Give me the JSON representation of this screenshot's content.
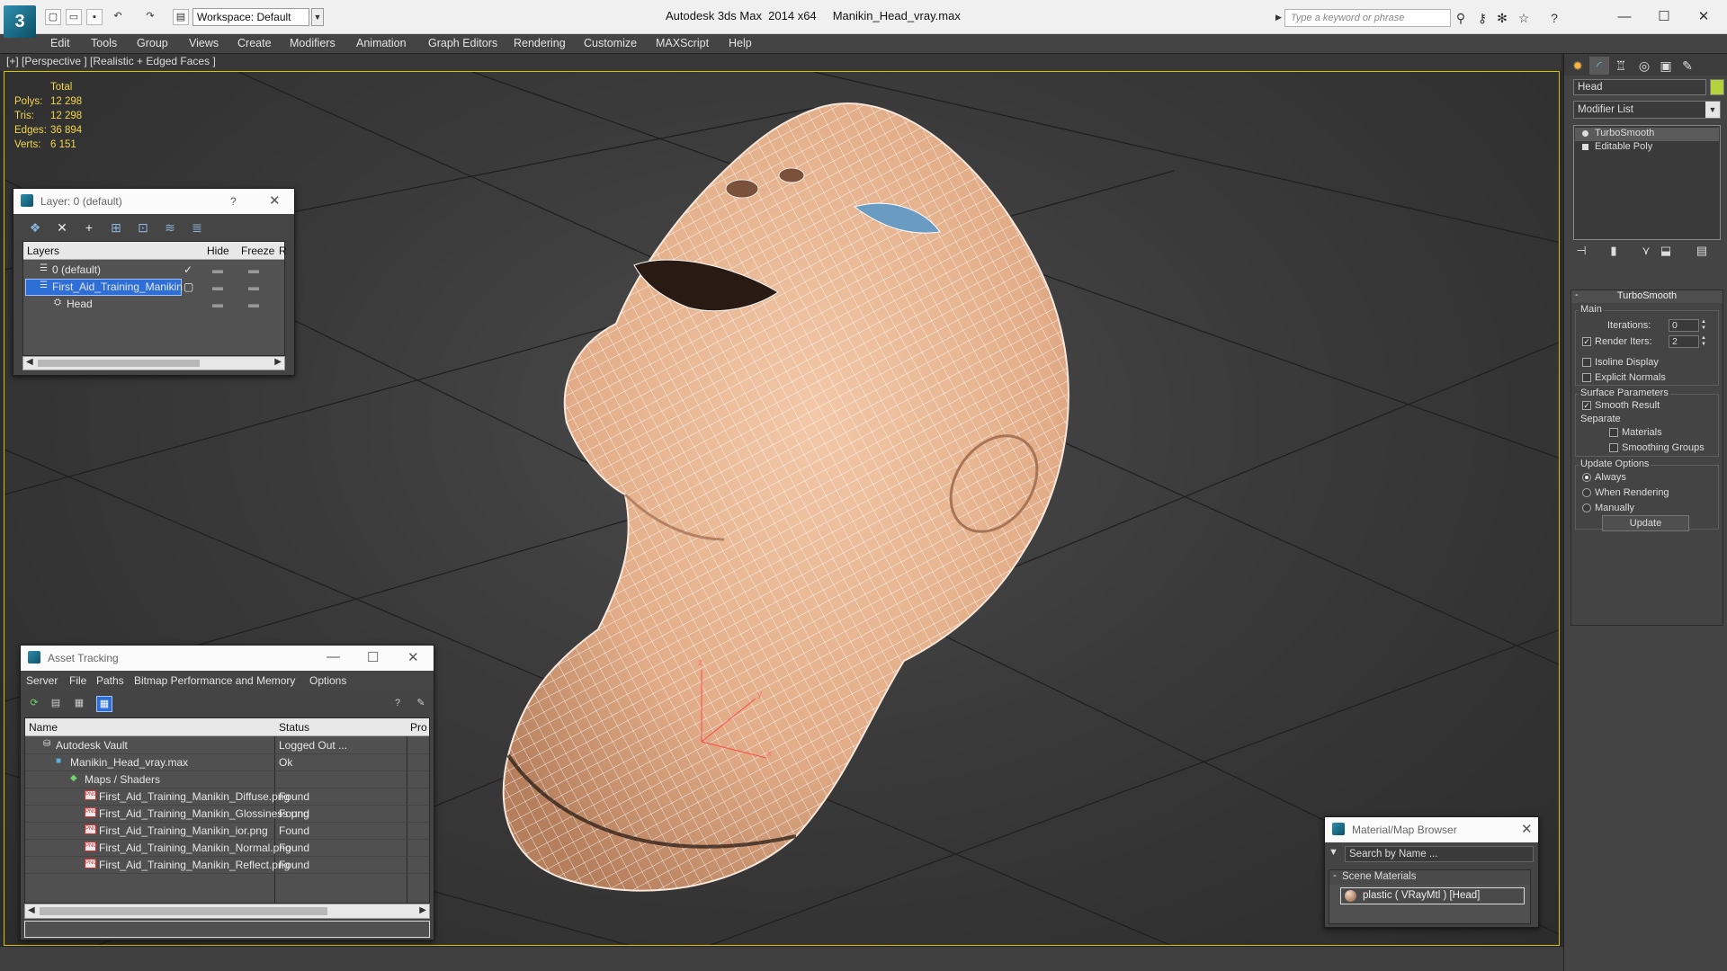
{
  "app": {
    "title": "Autodesk 3ds Max  2014 x64     Manikin_Head_vray.max",
    "workspace": "Workspace: Default",
    "search_placeholder": "Type a keyword or phrase"
  },
  "menu": [
    "Edit",
    "Tools",
    "Group",
    "Views",
    "Create",
    "Modifiers",
    "Animation",
    "Graph Editors",
    "Rendering",
    "Customize",
    "MAXScript",
    "Help"
  ],
  "viewport": {
    "label": "[+] [Perspective ] [Realistic + Edged Faces ]",
    "stats": {
      "header": "Total",
      "rows": [
        {
          "label": "Polys:",
          "value": "12 298"
        },
        {
          "label": "Tris:",
          "value": "12 298"
        },
        {
          "label": "Edges:",
          "value": "36 894"
        },
        {
          "label": "Verts:",
          "value": "6 151"
        }
      ]
    },
    "axis": {
      "x": "x",
      "y": "y",
      "z": "z"
    }
  },
  "layer_dialog": {
    "title": "Layer: 0 (default)",
    "help": "?",
    "columns": {
      "layers": "Layers",
      "hide": "Hide",
      "freeze": "Freeze",
      "r": "R"
    },
    "rows": [
      {
        "name": "0 (default)",
        "state": "current"
      },
      {
        "name": "First_Aid_Training_Manikin",
        "state": "selected"
      },
      {
        "name": "Head",
        "state": "object"
      }
    ]
  },
  "asset_dialog": {
    "title": "Asset Tracking",
    "menu": [
      "Server",
      "File",
      "Paths",
      "Bitmap Performance and Memory",
      "Options"
    ],
    "columns": {
      "name": "Name",
      "status": "Status",
      "proxy": "Pro"
    },
    "rows": [
      {
        "name": "Autodesk Vault",
        "status": "Logged Out ...",
        "level": 1,
        "icon": "vault-icon"
      },
      {
        "name": "Manikin_Head_vray.max",
        "status": "Ok",
        "level": 2,
        "icon": "max-file-icon"
      },
      {
        "name": "Maps / Shaders",
        "status": "",
        "level": 3,
        "icon": "maps-icon"
      },
      {
        "name": "First_Aid_Training_Manikin_Diffuse.png",
        "status": "Found",
        "level": 4,
        "icon": "png-icon"
      },
      {
        "name": "First_Aid_Training_Manikin_Glossiness.png",
        "status": "Found",
        "level": 4,
        "icon": "png-icon"
      },
      {
        "name": "First_Aid_Training_Manikin_ior.png",
        "status": "Found",
        "level": 4,
        "icon": "png-icon"
      },
      {
        "name": "First_Aid_Training_Manikin_Normal.png",
        "status": "Found",
        "level": 4,
        "icon": "png-icon"
      },
      {
        "name": "First_Aid_Training_Manikin_Reflect.png",
        "status": "Found",
        "level": 4,
        "icon": "png-icon"
      }
    ],
    "png_badge": "PNG"
  },
  "material_browser": {
    "title": "Material/Map Browser",
    "search_placeholder": "Search by Name ...",
    "group": "Scene Materials",
    "item": "plastic  ( VRayMtl )  [Head]"
  },
  "command_panel": {
    "object_name": "Head",
    "object_color": "#b4d23a",
    "modifier_list": "Modifier List",
    "stack": [
      "TurboSmooth",
      "Editable Poly"
    ],
    "turbosmooth": {
      "title": "TurboSmooth",
      "main": "Main",
      "iterations_label": "Iterations:",
      "iterations": "0",
      "render_iters_label": "Render Iters:",
      "render_iters": "2",
      "render_iters_checked": true,
      "isoline": "Isoline Display",
      "explicit_normals": "Explicit Normals",
      "surface_params": "Surface Parameters",
      "smooth_result": "Smooth Result",
      "separate": "Separate",
      "materials": "Materials",
      "smoothing_groups": "Smoothing Groups",
      "update_options": "Update Options",
      "always": "Always",
      "when_rendering": "When Rendering",
      "manually": "Manually",
      "update_button": "Update"
    }
  },
  "colors": {
    "viewport_border": "#d6c200",
    "stats_text": "#f3d64a",
    "selection": "#2d6fd6",
    "skin": "#e9b896"
  }
}
